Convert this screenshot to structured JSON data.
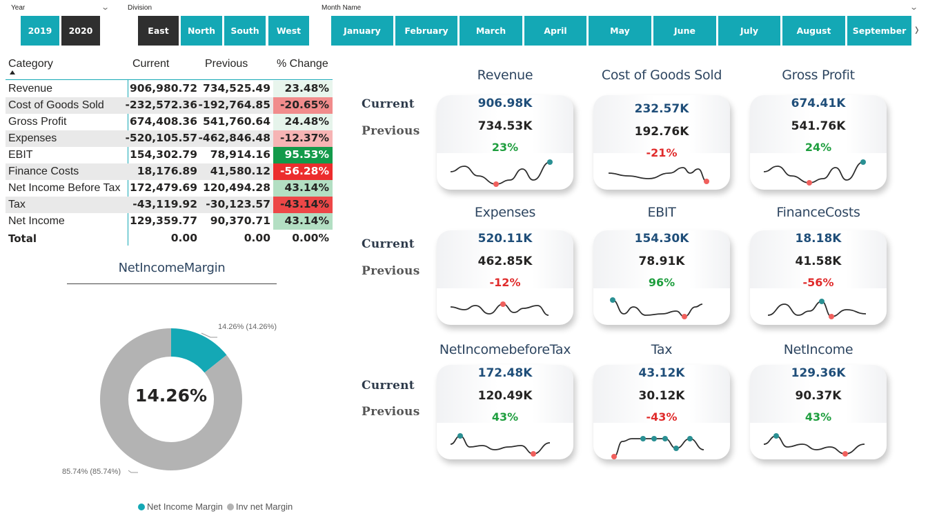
{
  "slicers": {
    "year": {
      "title": "Year",
      "options": [
        "2019",
        "2020"
      ],
      "selected": "2020"
    },
    "division": {
      "title": "Division",
      "options": [
        "East",
        "North",
        "South",
        "West"
      ],
      "selected": "East"
    },
    "month": {
      "title": "Month Name",
      "options": [
        "January",
        "February",
        "March",
        "April",
        "May",
        "June",
        "July",
        "August",
        "September"
      ]
    }
  },
  "table": {
    "headers": {
      "category": "Category",
      "current": "Current",
      "previous": "Previous",
      "change": "% Change"
    },
    "rows": [
      {
        "category": "Revenue",
        "current": "906,980.72",
        "previous": "734,525.49",
        "change": "23.48%",
        "color": "#e8f5ed"
      },
      {
        "category": "Cost of Goods Sold",
        "current": "-232,572.36",
        "previous": "-192,764.85",
        "change": "-20.65%",
        "color": "#f18c8c"
      },
      {
        "category": "Gross Profit",
        "current": "674,408.36",
        "previous": "541,760.64",
        "change": "24.48%",
        "color": "#e6f4eb"
      },
      {
        "category": "Expenses",
        "current": "-520,105.57",
        "previous": "-462,846.48",
        "change": "-12.37%",
        "color": "#f6b4b4"
      },
      {
        "category": "EBIT",
        "current": "154,302.79",
        "previous": "78,914.16",
        "change": "95.53%",
        "color": "#139a4a"
      },
      {
        "category": "Finance Costs",
        "current": "18,176.89",
        "previous": "41,580.12",
        "change": "-56.28%",
        "color": "#ec2d2d"
      },
      {
        "category": "Net Income Before Tax",
        "current": "172,479.69",
        "previous": "120,494.28",
        "change": "43.14%",
        "color": "#b3dfc3"
      },
      {
        "category": "Tax",
        "current": "-43,119.92",
        "previous": "-30,123.57",
        "change": "-43.14%",
        "color": "#ed4747"
      },
      {
        "category": "Net Income",
        "current": "129,359.77",
        "previous": "90,370.71",
        "change": "43.14%",
        "color": "#b3dfc3"
      }
    ],
    "total": {
      "category": "Total",
      "current": "0.00",
      "previous": "0.00",
      "change": "0.00%"
    }
  },
  "donut": {
    "title": "NetIncomeMargin",
    "center": "14.26%",
    "label_a": "14.26% (14.26%)",
    "label_b": "85.74% (85.74%)",
    "legend": [
      {
        "name": "Net Income Margin",
        "color": "#14a8b5"
      },
      {
        "name": "Inv net Margin",
        "color": "#b3b3b3"
      }
    ],
    "chart_data": {
      "type": "pie",
      "categories": [
        "Net Income Margin",
        "Inv net Margin"
      ],
      "values": [
        14.26,
        85.74
      ]
    }
  },
  "row_labels": {
    "current": "Current",
    "previous": "Previous"
  },
  "kpis": [
    {
      "title": "Revenue",
      "current": "906.98K",
      "previous": "734.53K",
      "change": "23%",
      "positive": true
    },
    {
      "title": "Cost of Goods Sold",
      "current": "232.57K",
      "previous": "192.76K",
      "change": "-21%",
      "positive": false
    },
    {
      "title": "Gross Profit",
      "current": "674.41K",
      "previous": "541.76K",
      "change": "24%",
      "positive": true
    },
    {
      "title": "Expenses",
      "current": "520.11K",
      "previous": "462.85K",
      "change": "-12%",
      "positive": false
    },
    {
      "title": "EBIT",
      "current": "154.30K",
      "previous": "78.91K",
      "change": "96%",
      "positive": true
    },
    {
      "title": "FinanceCosts",
      "current": "18.18K",
      "previous": "41.58K",
      "change": "-56%",
      "positive": false
    },
    {
      "title": "NetIncomebeforeTax",
      "current": "172.48K",
      "previous": "120.49K",
      "change": "43%",
      "positive": true
    },
    {
      "title": "Tax",
      "current": "43.12K",
      "previous": "30.12K",
      "change": "-43%",
      "positive": false
    },
    {
      "title": "NetIncome",
      "current": "129.36K",
      "previous": "90.37K",
      "change": "43%",
      "positive": true
    }
  ],
  "colors": {
    "accent": "#14a8b5",
    "positive": "#1e9e3e",
    "negative": "#e02b2b",
    "selected": "#2f2f2f"
  }
}
